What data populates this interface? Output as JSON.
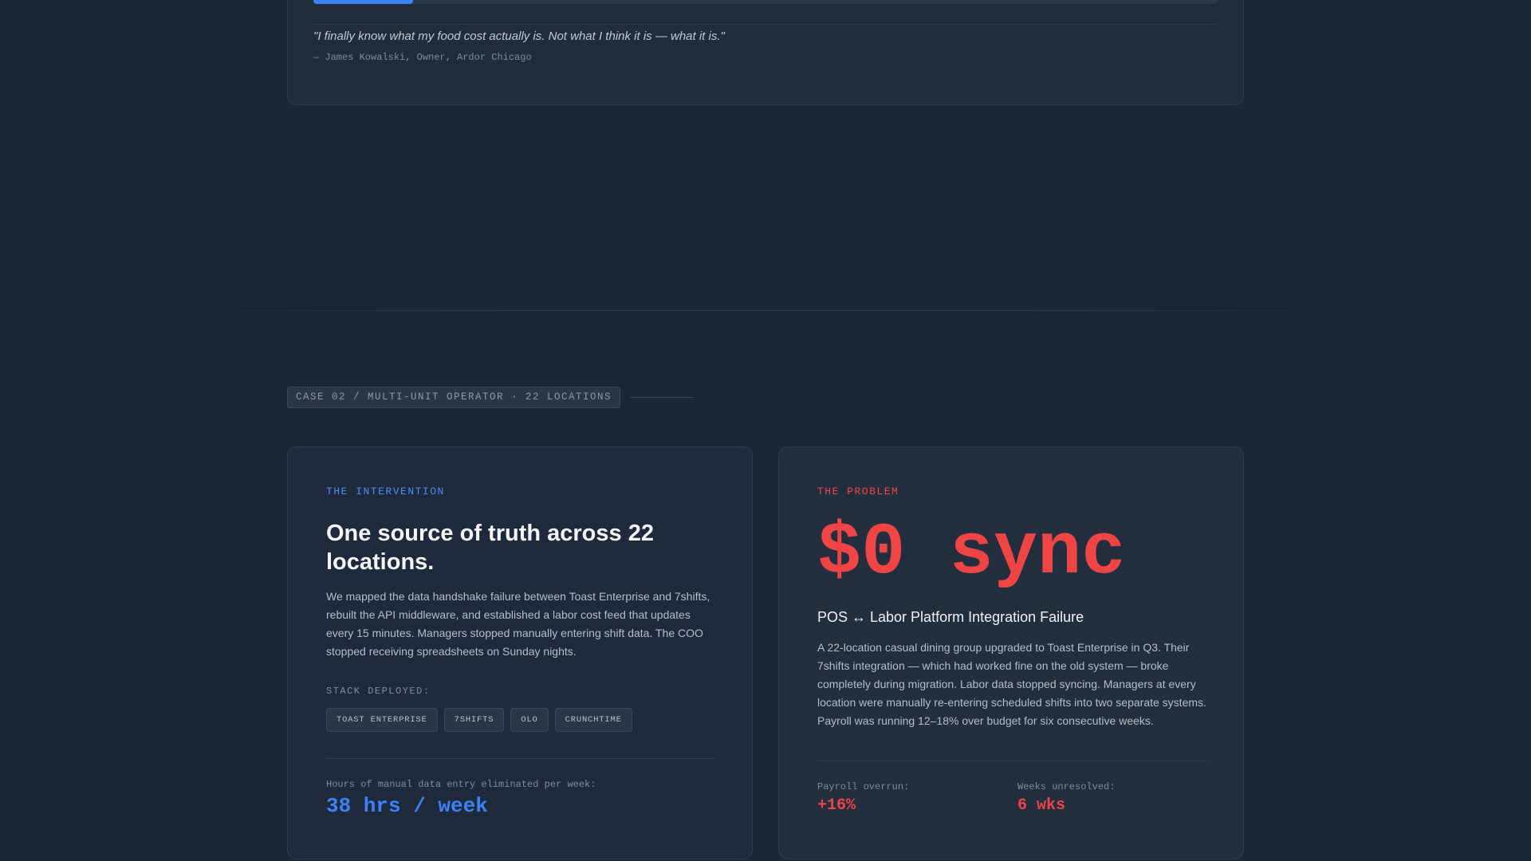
{
  "case01": {
    "progress_percent": 11,
    "quote": "\"I finally know what my food cost actually is. Not what I think it is — what it is.\"",
    "attribution": "— James Kowalski, Owner, Ardor Chicago"
  },
  "case02": {
    "label": "CASE 02 / MULTI-UNIT OPERATOR · 22 LOCATIONS",
    "intervention": {
      "eyebrow": "THE INTERVENTION",
      "headline": "One source of truth across 22 locations.",
      "body": "We mapped the data handshake failure between Toast Enterprise and 7shifts, rebuilt the API middleware, and established a labor cost feed that updates every 15 minutes. Managers stopped manually entering shift data. The COO stopped receiving spreadsheets on Sunday nights.",
      "stack_label": "STACK DEPLOYED:",
      "stack": [
        "TOAST ENTERPRISE",
        "7SHIFTS",
        "OLO",
        "CRUNCHTIME"
      ],
      "metric_label": "Hours of manual data entry eliminated per week:",
      "metric_value": "38 hrs / week"
    },
    "problem": {
      "eyebrow": "THE PROBLEM",
      "big_stat": "$0 sync",
      "title": "POS ↔ Labor Platform Integration Failure",
      "body": "A 22-location casual dining group upgraded to Toast Enterprise in Q3. Their 7shifts integration — which had worked fine on the old system — broke completely during migration. Labor data stopped syncing. Managers at every location were manually re-entering scheduled shifts into two separate systems. Payroll was running 12–18% over budget for six consecutive weeks.",
      "metrics": [
        {
          "label": "Payroll overrun:",
          "value": "+16%"
        },
        {
          "label": "Weeks unresolved:",
          "value": "6 wks"
        }
      ]
    }
  },
  "colors": {
    "background": "#1b2533",
    "accent_blue": "#3b82f6",
    "accent_red": "#ef4444"
  }
}
